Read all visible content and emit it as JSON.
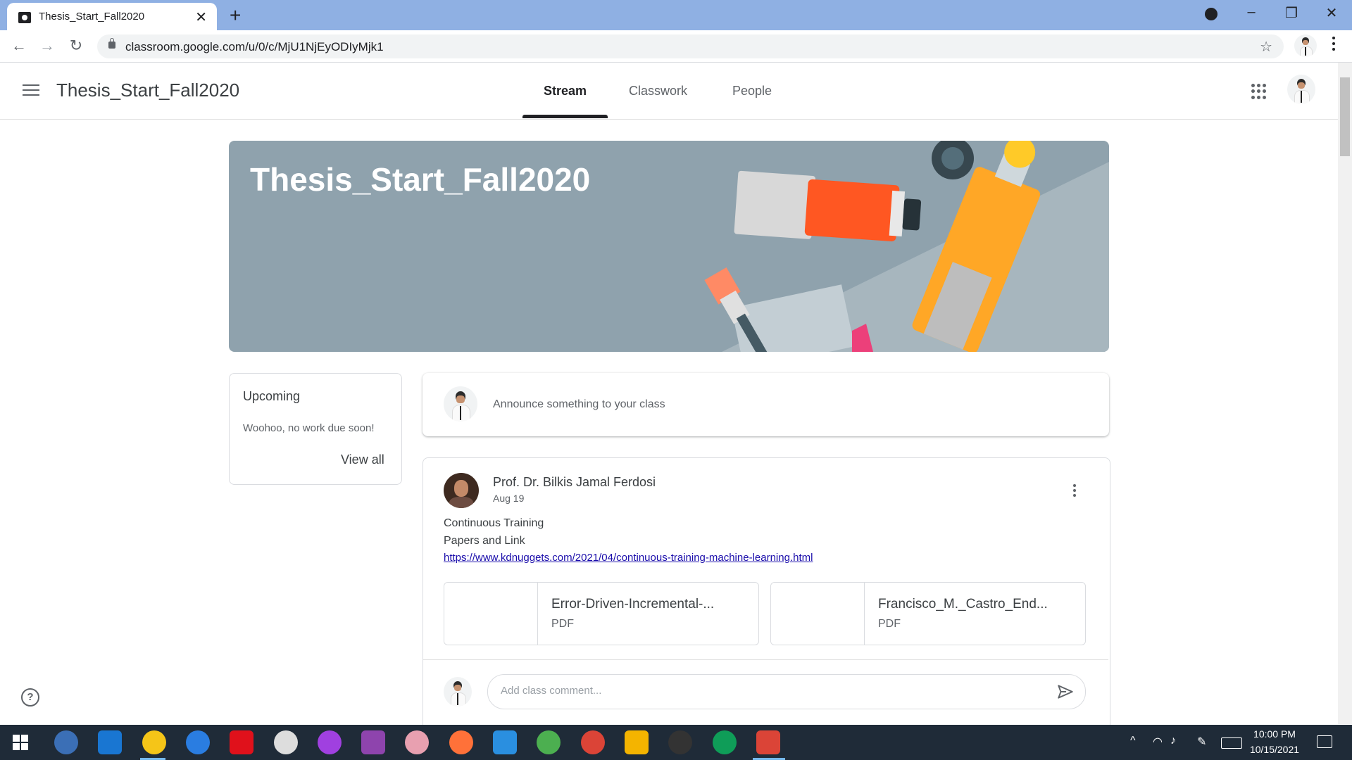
{
  "browser": {
    "tab_title": "Thesis_Start_Fall2020",
    "tab_close": "✕",
    "new_tab": "+",
    "url": "classroom.google.com/u/0/c/MjU1NjEyODIyMjk1",
    "min": "–",
    "restore": "❐",
    "close": "✕",
    "back": "←",
    "forward": "→",
    "reload": "↻",
    "bookmark": "☆"
  },
  "app": {
    "class_title": "Thesis_Start_Fall2020",
    "tabs": [
      {
        "label": "Stream"
      },
      {
        "label": "Classwork"
      },
      {
        "label": "People"
      }
    ]
  },
  "banner": {
    "title": "Thesis_Start_Fall2020"
  },
  "upcoming": {
    "title": "Upcoming",
    "message": "Woohoo, no work due soon!",
    "view_all": "View all"
  },
  "announce": {
    "placeholder": "Announce something to your class"
  },
  "post": {
    "author": "Prof. Dr. Bilkis Jamal Ferdosi",
    "date": "Aug 19",
    "lines": [
      "Continuous Training",
      "Papers and Link"
    ],
    "link": "https://www.kdnuggets.com/2021/04/continuous-training-machine-learning.html",
    "attachments": [
      {
        "name": "Error-Driven-Incremental-...",
        "type": "PDF"
      },
      {
        "name": "Francisco_M._Castro_End...",
        "type": "PDF"
      }
    ],
    "comment_placeholder": "Add class comment..."
  },
  "help": "?",
  "taskbar": {
    "time": "10:00 PM",
    "date": "10/15/2021",
    "apps": [
      {
        "icon": "qbittorrent-icon",
        "color": "#3b6fb6"
      },
      {
        "icon": "edge-icon",
        "color": "#1976d2"
      },
      {
        "icon": "file-explorer-icon",
        "color": "#f5c518"
      },
      {
        "icon": "mail-icon",
        "color": "#2a7de1"
      },
      {
        "icon": "opera-icon",
        "color": "#e0111b"
      },
      {
        "icon": "app-icon",
        "color": "#dddddd"
      },
      {
        "icon": "messenger-icon",
        "color": "#a040e0"
      },
      {
        "icon": "github-desktop-icon",
        "color": "#8e44ad"
      },
      {
        "icon": "paint-icon",
        "color": "#e8a0b0"
      },
      {
        "icon": "firefox-icon",
        "color": "#ff7139"
      },
      {
        "icon": "vscode-icon",
        "color": "#2a8fe0"
      },
      {
        "icon": "app-icon-2",
        "color": "#4caf50"
      },
      {
        "icon": "chrome-icon",
        "color": "#db4437"
      },
      {
        "icon": "chrome-icon-2",
        "color": "#f4b400"
      },
      {
        "icon": "terminal-icon",
        "color": "#333333"
      },
      {
        "icon": "chrome-profile-icon",
        "color": "#0f9d58"
      },
      {
        "icon": "chrome-active-icon",
        "color": "#db4437"
      }
    ]
  }
}
